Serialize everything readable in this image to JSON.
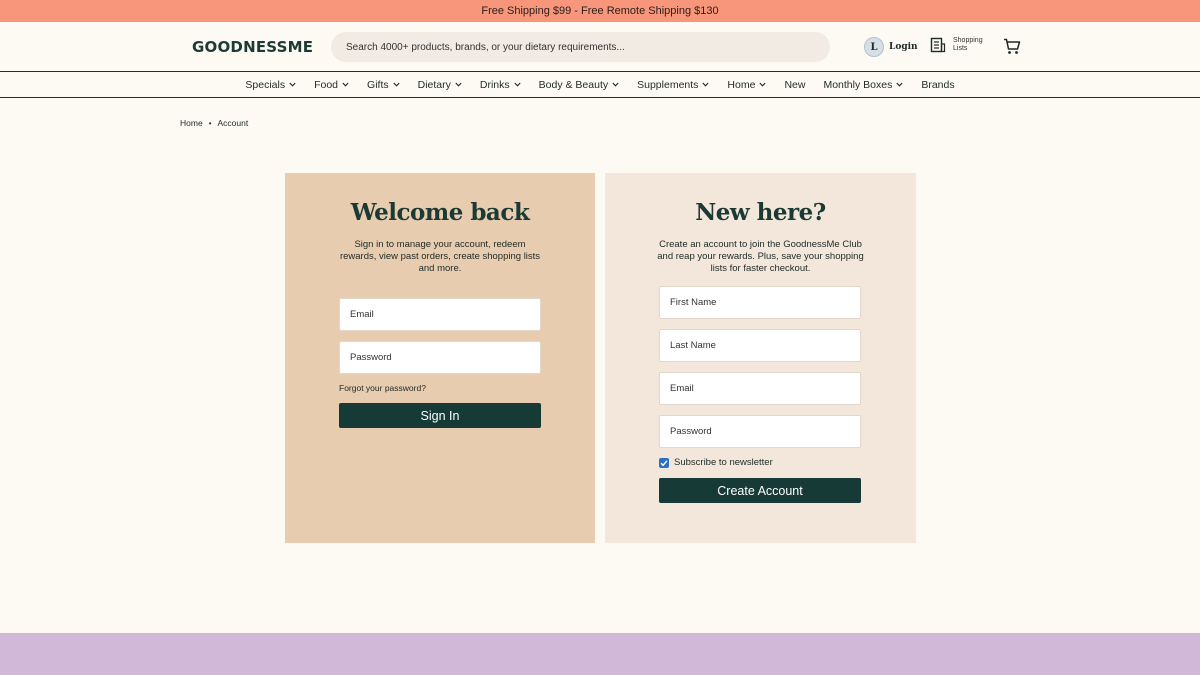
{
  "promo": {
    "text": "Free Shipping $99 - Free Remote Shipping $130"
  },
  "header": {
    "logo": "GOODNESSME",
    "search_placeholder": "Search 4000+ products, brands, or your dietary requirements...",
    "login_initial": "L",
    "login_label": "Login",
    "lists_label": "Shopping Lists",
    "icons": {
      "lists": "list-document-icon",
      "cart": "cart-icon"
    }
  },
  "nav": {
    "items": [
      {
        "label": "Specials",
        "dropdown": true
      },
      {
        "label": "Food",
        "dropdown": true
      },
      {
        "label": "Gifts",
        "dropdown": true
      },
      {
        "label": "Dietary",
        "dropdown": true
      },
      {
        "label": "Drinks",
        "dropdown": true
      },
      {
        "label": "Body & Beauty",
        "dropdown": true
      },
      {
        "label": "Supplements",
        "dropdown": true
      },
      {
        "label": "Home",
        "dropdown": true
      },
      {
        "label": "New",
        "dropdown": false
      },
      {
        "label": "Monthly Boxes",
        "dropdown": true
      },
      {
        "label": "Brands",
        "dropdown": false
      }
    ]
  },
  "breadcrumb": {
    "home": "Home",
    "separator": "•",
    "current": "Account"
  },
  "login_panel": {
    "title": "Welcome back",
    "description": "Sign in to manage your account, redeem rewards, view past orders, create shopping lists and more.",
    "email_placeholder": "Email",
    "password_placeholder": "Password",
    "forgot_label": "Forgot your password?",
    "submit_label": "Sign In"
  },
  "register_panel": {
    "title": "New here?",
    "description": "Create an account to join the GoodnessMe Club and reap your rewards. Plus, save your shopping lists for faster checkout.",
    "first_name_placeholder": "First Name",
    "last_name_placeholder": "Last Name",
    "email_placeholder": "Email",
    "password_placeholder": "Password",
    "newsletter_label": "Subscribe to newsletter",
    "newsletter_checked": true,
    "submit_label": "Create Account"
  },
  "colors": {
    "promo": "#f7967a",
    "login_panel": "#e8ccaf",
    "register_panel": "#f3e6db",
    "button": "#163a35",
    "footer_band": "#d1b8d9"
  }
}
